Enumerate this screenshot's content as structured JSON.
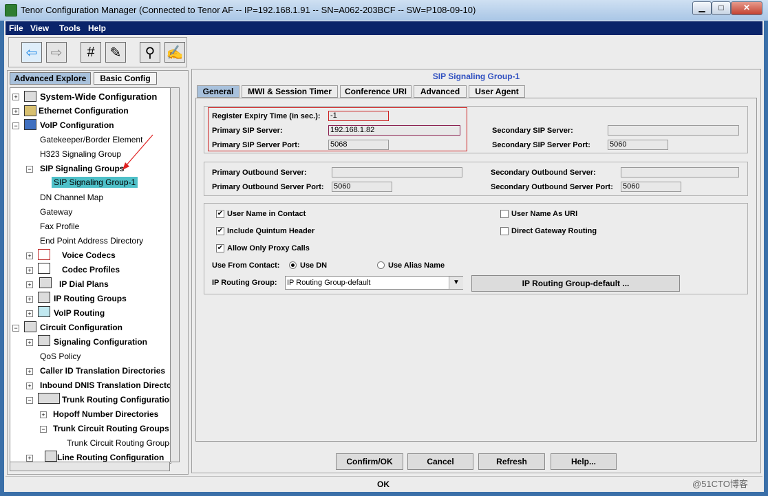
{
  "window": {
    "title": "Tenor Configuration Manager (Connected to Tenor AF -- IP=192.168.1.91 -- SN=A062-203BCF -- SW=P108-09-10)",
    "minimize": "▁",
    "maximize": "□",
    "close": "✕"
  },
  "menu": [
    "File",
    "View",
    "Tools",
    "Help"
  ],
  "left_tabs": {
    "advanced": "Advanced Explore",
    "basic": "Basic Config"
  },
  "tree": [
    {
      "label": "System-Wide Configuration"
    },
    {
      "label": "Ethernet Configuration"
    },
    {
      "label": "VoIP Configuration"
    },
    {
      "label": "Gatekeeper/Border Element"
    },
    {
      "label": "H323 Signaling Group"
    },
    {
      "label": "SIP Signaling Groups"
    },
    {
      "label": "SIP Signaling Group-1"
    },
    {
      "label": "DN Channel Map"
    },
    {
      "label": "Gateway"
    },
    {
      "label": "Fax Profile"
    },
    {
      "label": "End Point Address Directory"
    },
    {
      "label": "Voice Codecs"
    },
    {
      "label": "Codec Profiles"
    },
    {
      "label": "IP Dial Plans"
    },
    {
      "label": "IP Routing Groups"
    },
    {
      "label": "VoIP Routing"
    },
    {
      "label": "Circuit Configuration"
    },
    {
      "label": "Signaling Configuration"
    },
    {
      "label": "QoS Policy"
    },
    {
      "label": "Caller ID Translation Directories"
    },
    {
      "label": "Inbound DNIS Translation Directories"
    },
    {
      "label": "Trunk Routing Configuration"
    },
    {
      "label": "Hopoff Number Directories"
    },
    {
      "label": "Trunk Circuit Routing Groups"
    },
    {
      "label": "Trunk Circuit Routing Group-line"
    },
    {
      "label": "Line Routing Configuration"
    }
  ],
  "panel_title": "SIP Signaling Group-1",
  "tabs": [
    "General",
    "MWI & Session Timer",
    "Conference URI",
    "Advanced",
    "User Agent"
  ],
  "server": {
    "register_expiry_label": "Register Expiry Time (in sec.):",
    "register_expiry_value": "-1",
    "primary_sip_label": "Primary SIP Server:",
    "primary_sip_value": "192.168.1.82",
    "primary_port_label": "Primary SIP Server Port:",
    "primary_port_value": "5068",
    "secondary_sip_label": "Secondary SIP Server:",
    "secondary_sip_value": "",
    "secondary_port_label": "Secondary SIP Server Port:",
    "secondary_port_value": "5060"
  },
  "outbound": {
    "primary_label": "Primary Outbound Server:",
    "primary_value": "",
    "primary_port_label": "Primary Outbound Server Port:",
    "primary_port_value": "5060",
    "secondary_label": "Secondary Outbound Server:",
    "secondary_value": "",
    "secondary_port_label": "Secondary Outbound Server Port:",
    "secondary_port_value": "5060"
  },
  "options": {
    "user_name_in_contact": "User Name in Contact",
    "include_quintum_header": "Include Quintum Header",
    "allow_only_proxy_calls": "Allow Only Proxy Calls",
    "user_name_as_uri": "User Name As URI",
    "direct_gateway_routing": "Direct Gateway Routing",
    "use_from_contact_label": "Use From Contact:",
    "use_dn": "Use DN",
    "use_alias_name": "Use Alias Name",
    "ip_routing_group_label": "IP Routing Group:",
    "ip_routing_group_value": "IP Routing Group-default",
    "ip_routing_group_button": "IP Routing Group-default ..."
  },
  "buttons": {
    "confirm": "Confirm/OK",
    "cancel": "Cancel",
    "refresh": "Refresh",
    "help": "Help..."
  },
  "status": "OK",
  "watermark": "@51CTO博客",
  "colors": {
    "highlight_red": "#cc2020",
    "selection": "#4ec0c8",
    "tab_active": "#a8c1dc",
    "title_blue": "#3050c0"
  }
}
